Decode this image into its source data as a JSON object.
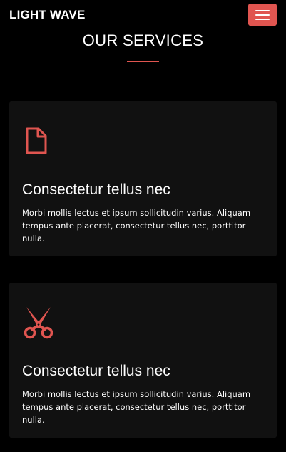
{
  "navbar": {
    "brand": "LIGHT WAVE",
    "menu_icon": "hamburger-icon",
    "menu_color": "#e05550"
  },
  "section": {
    "title": "OUR SERVICES",
    "accent_color": "#e05550"
  },
  "cards": [
    {
      "icon": "document-icon",
      "title": "Consectetur tellus nec",
      "text": "Morbi mollis lectus et ipsum sollicitudin varius. Aliquam tempus ante placerat, consectetur tellus nec, porttitor nulla."
    },
    {
      "icon": "scissors-icon",
      "title": "Consectetur tellus nec",
      "text": "Morbi mollis lectus et ipsum sollicitudin varius. Aliquam tempus ante placerat, consectetur tellus nec, porttitor nulla."
    }
  ]
}
